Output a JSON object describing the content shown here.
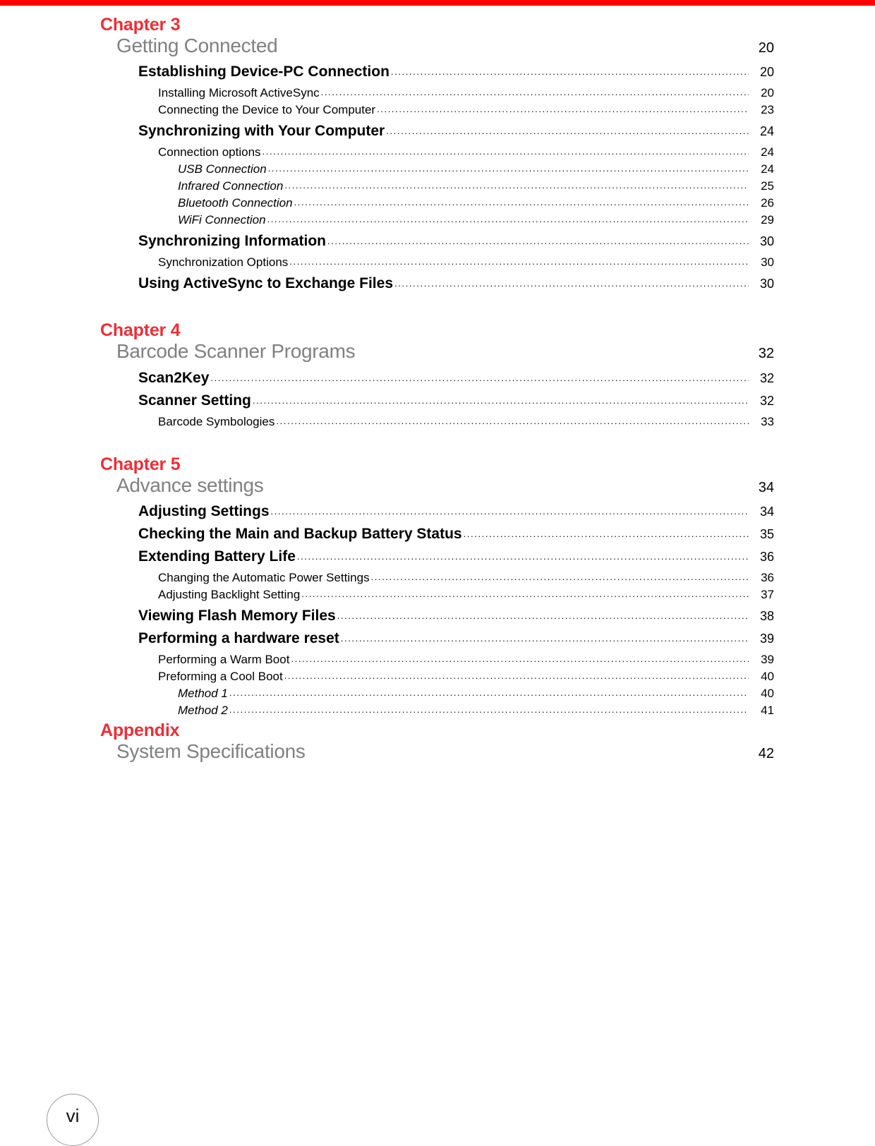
{
  "page": {
    "folio": "vi",
    "accent_red": "#ED2E38",
    "rule_red": "#FF0000",
    "subtitle_gray": "#808080"
  },
  "toc": {
    "chapters": [
      {
        "chapter_label": "Chapter 3",
        "chapter_title": "Getting Connected",
        "chapter_page": "20",
        "entries": [
          {
            "level": 1,
            "label": "Establishing Device-PC Connection",
            "page": "20"
          },
          {
            "level": 2,
            "label": "Installing Microsoft ActiveSync",
            "page": "20"
          },
          {
            "level": 2,
            "label": "Connecting the Device to Your Computer",
            "page": "23"
          },
          {
            "level": 1,
            "label": "Synchronizing with Your Computer",
            "page": "24"
          },
          {
            "level": 2,
            "label": "Connection options",
            "page": "24"
          },
          {
            "level": 3,
            "label": "USB Connection",
            "page": "24"
          },
          {
            "level": 3,
            "label": "Infrared Connection",
            "page": "25"
          },
          {
            "level": 3,
            "label": "Bluetooth Connection",
            "page": "26"
          },
          {
            "level": 3,
            "label": "WiFi Connection",
            "page": "29"
          },
          {
            "level": 1,
            "label": "Synchronizing Information",
            "page": "30"
          },
          {
            "level": 2,
            "label": "Synchronization Options",
            "page": "30"
          },
          {
            "level": 1,
            "label": "Using ActiveSync to Exchange Files",
            "page": "30"
          }
        ]
      },
      {
        "chapter_label": "Chapter 4",
        "chapter_title": "Barcode Scanner Programs",
        "chapter_page": "32",
        "entries": [
          {
            "level": 1,
            "label": "Scan2Key",
            "page": "32"
          },
          {
            "level": 1,
            "label": "Scanner Setting",
            "page": "32"
          },
          {
            "level": 2,
            "label": "Barcode Symbologies",
            "page": "33"
          }
        ]
      },
      {
        "chapter_label": "Chapter 5",
        "chapter_title": "Advance settings",
        "chapter_page": "34",
        "entries": [
          {
            "level": 1,
            "label": "Adjusting Settings",
            "page": "34"
          },
          {
            "level": 1,
            "label": "Checking the Main and Backup Battery Status",
            "page": "35"
          },
          {
            "level": 1,
            "label": "Extending Battery Life",
            "page": "36"
          },
          {
            "level": 2,
            "label": "Changing the Automatic Power Settings",
            "page": "36"
          },
          {
            "level": 2,
            "label": "Adjusting Backlight Setting",
            "page": "37"
          },
          {
            "level": 1,
            "label": "Viewing Flash Memory Files",
            "page": "38"
          },
          {
            "level": 1,
            "label": "Performing a hardware reset",
            "page": "39"
          },
          {
            "level": 2,
            "label": "Performing a Warm Boot",
            "page": "39"
          },
          {
            "level": 2,
            "label": "Preforming a Cool Boot",
            "page": "40"
          },
          {
            "level": 3,
            "label": "Method 1",
            "page": "40"
          },
          {
            "level": 3,
            "label": "Method 2",
            "page": "41"
          }
        ]
      },
      {
        "chapter_label": "Appendix",
        "chapter_title": "System Specifications",
        "chapter_page": "42",
        "entries": []
      }
    ]
  }
}
